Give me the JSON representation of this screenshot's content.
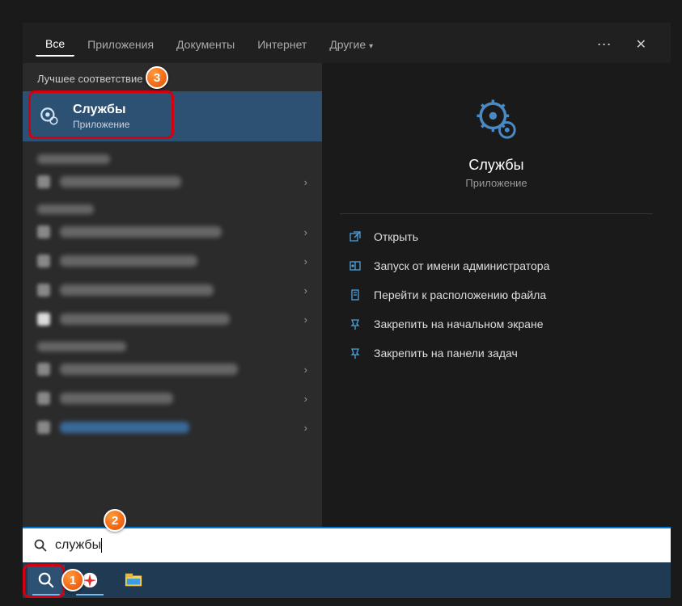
{
  "tabs": {
    "all": "Все",
    "apps": "Приложения",
    "docs": "Документы",
    "web": "Интернет",
    "other": "Другие"
  },
  "left": {
    "best_match_label": "Лучшее соответствие",
    "result": {
      "title": "Службы",
      "subtitle": "Приложение"
    }
  },
  "preview": {
    "title": "Службы",
    "subtitle": "Приложение",
    "actions": {
      "open": "Открыть",
      "admin": "Запуск от имени администратора",
      "location": "Перейти к расположению файла",
      "pin_start": "Закрепить на начальном экране",
      "pin_task": "Закрепить на панели задач"
    }
  },
  "search": {
    "value": "службы"
  },
  "badges": {
    "b1": "1",
    "b2": "2",
    "b3": "3"
  }
}
